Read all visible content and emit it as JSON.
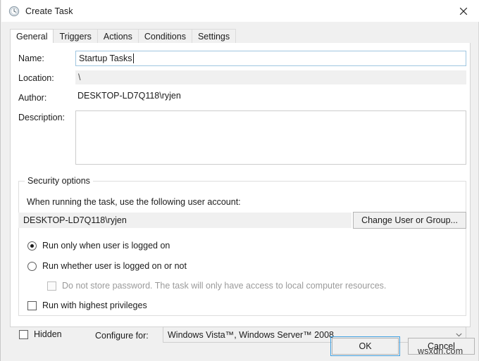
{
  "window": {
    "title": "Create Task",
    "icon": "clock-task-icon",
    "close_label": "✕"
  },
  "tabs": [
    {
      "label": "General",
      "active": true
    },
    {
      "label": "Triggers",
      "active": false
    },
    {
      "label": "Actions",
      "active": false
    },
    {
      "label": "Conditions",
      "active": false
    },
    {
      "label": "Settings",
      "active": false
    }
  ],
  "general": {
    "name_label": "Name:",
    "name_value": "Startup Tasks",
    "location_label": "Location:",
    "location_value": "\\",
    "author_label": "Author:",
    "author_value": "DESKTOP-LD7Q118\\ryjen",
    "description_label": "Description:",
    "description_value": ""
  },
  "security": {
    "group_title": "Security options",
    "account_note": "When running the task, use the following user account:",
    "account_value": "DESKTOP-LD7Q118\\ryjen",
    "change_button": "Change User or Group...",
    "run_only_logged_on": "Run only when user is logged on",
    "run_whether_logged_on": "Run whether user is logged on or not",
    "do_not_store_password": "Do not store password.  The task will only have access to local computer resources.",
    "run_highest_privileges": "Run with highest privileges",
    "selected_run_mode": "run_only_logged_on"
  },
  "footer_options": {
    "hidden_label": "Hidden",
    "configure_for_label": "Configure for:",
    "configure_for_value": "Windows Vista™, Windows Server™ 2008"
  },
  "buttons": {
    "ok": "OK",
    "cancel": "Cancel"
  },
  "watermark": "wsxdn.com",
  "colors": {
    "focus_outline": "#3f9fe0",
    "input_focus_border": "#9fc6e0",
    "panel_bg": "#ffffff",
    "dialog_bg": "#f0f0f0"
  }
}
